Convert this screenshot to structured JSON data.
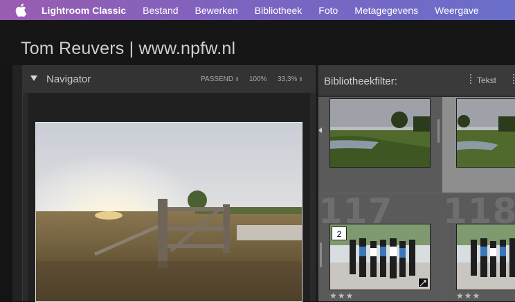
{
  "menubar": {
    "apple_icon": "apple-logo-icon",
    "app_name": "Lightroom Classic",
    "items": [
      "Bestand",
      "Bewerken",
      "Bibliotheek",
      "Foto",
      "Metagegevens",
      "Weergave"
    ]
  },
  "identity_plate": "Tom Reuvers | www.npfw.nl",
  "navigator": {
    "title": "Navigator",
    "zoom": [
      "PASSEND",
      "100%",
      "33,3%"
    ]
  },
  "library_filter": {
    "label": "Bibliotheekfilter:",
    "text_option": "Tekst"
  },
  "grid": {
    "cells": [
      {
        "number": "117",
        "stack_count": "2",
        "rating": "★★★"
      },
      {
        "number": "118",
        "rating": "★★★"
      }
    ]
  },
  "colors": {
    "menubar_start": "#9a5cb0",
    "menubar_end": "#6a6fca",
    "panel_bg": "#2a2a2a",
    "grid_bg": "#5e5e5e"
  }
}
